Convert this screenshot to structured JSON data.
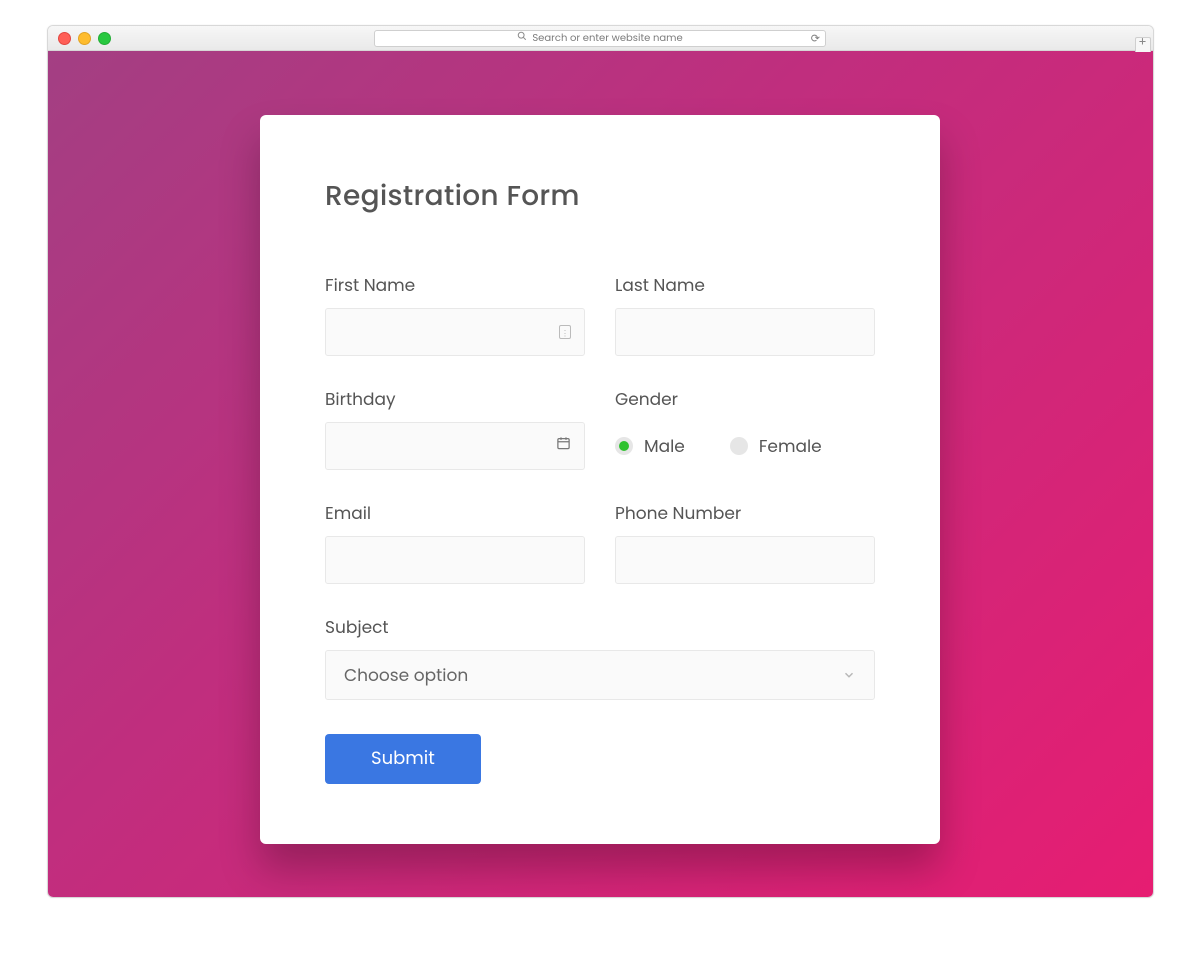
{
  "browser": {
    "address_placeholder": "Search or enter website name"
  },
  "form": {
    "title": "Registration Form",
    "first_name": {
      "label": "First Name",
      "value": ""
    },
    "last_name": {
      "label": "Last Name",
      "value": ""
    },
    "birthday": {
      "label": "Birthday",
      "value": ""
    },
    "gender": {
      "label": "Gender",
      "options": [
        {
          "label": "Male",
          "selected": true
        },
        {
          "label": "Female",
          "selected": false
        }
      ]
    },
    "email": {
      "label": "Email",
      "value": ""
    },
    "phone": {
      "label": "Phone Number",
      "value": ""
    },
    "subject": {
      "label": "Subject",
      "selected": "Choose option"
    },
    "submit_label": "Submit"
  },
  "colors": {
    "gradient_start": "#a33f83",
    "gradient_end": "#e61d72",
    "primary_button": "#3a77e2",
    "radio_selected": "#2fc22f"
  }
}
